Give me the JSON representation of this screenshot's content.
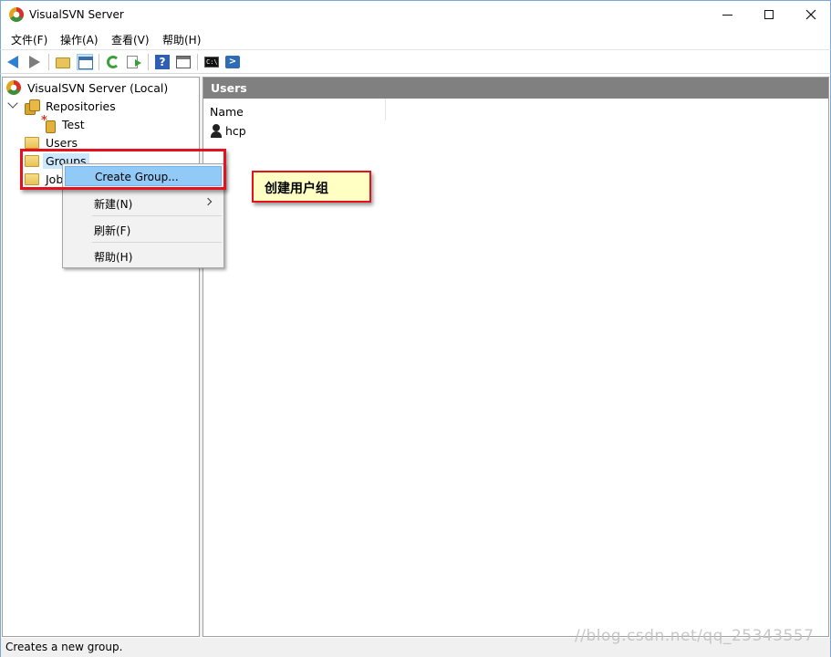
{
  "window": {
    "title": "VisualSVN Server",
    "icon": "visualsvn-logo-icon"
  },
  "menubar": {
    "items": [
      "文件(F)",
      "操作(A)",
      "查看(V)",
      "帮助(H)"
    ]
  },
  "toolbar": {
    "icons": [
      "back-arrow-icon",
      "forward-arrow-icon",
      "up-folder-icon",
      "show-hide-tree-icon",
      "refresh-icon",
      "export-list-icon",
      "help-icon",
      "properties-icon",
      "command-prompt-icon",
      "powershell-icon"
    ],
    "cmd_glyph": "C:\\",
    "help_glyph": "?"
  },
  "tree": {
    "root": "VisualSVN Server (Local)",
    "repositories": "Repositories",
    "repo_test": "Test",
    "users": "Users",
    "groups": "Groups",
    "jobs_partial": "Job"
  },
  "right_pane": {
    "header": "Users",
    "column_name": "Name",
    "rows": [
      "hcp"
    ]
  },
  "context_menu": {
    "items": [
      "Create Group...",
      "新建(N)",
      "刷新(F)",
      "帮助(H)"
    ]
  },
  "annotation": {
    "callout_text": "创建用户组",
    "highlight_color": "#e4121e"
  },
  "status_bar": {
    "text": "Creates a new group."
  },
  "watermark": {
    "text": "//blog.csdn.net/qq_25343557"
  }
}
